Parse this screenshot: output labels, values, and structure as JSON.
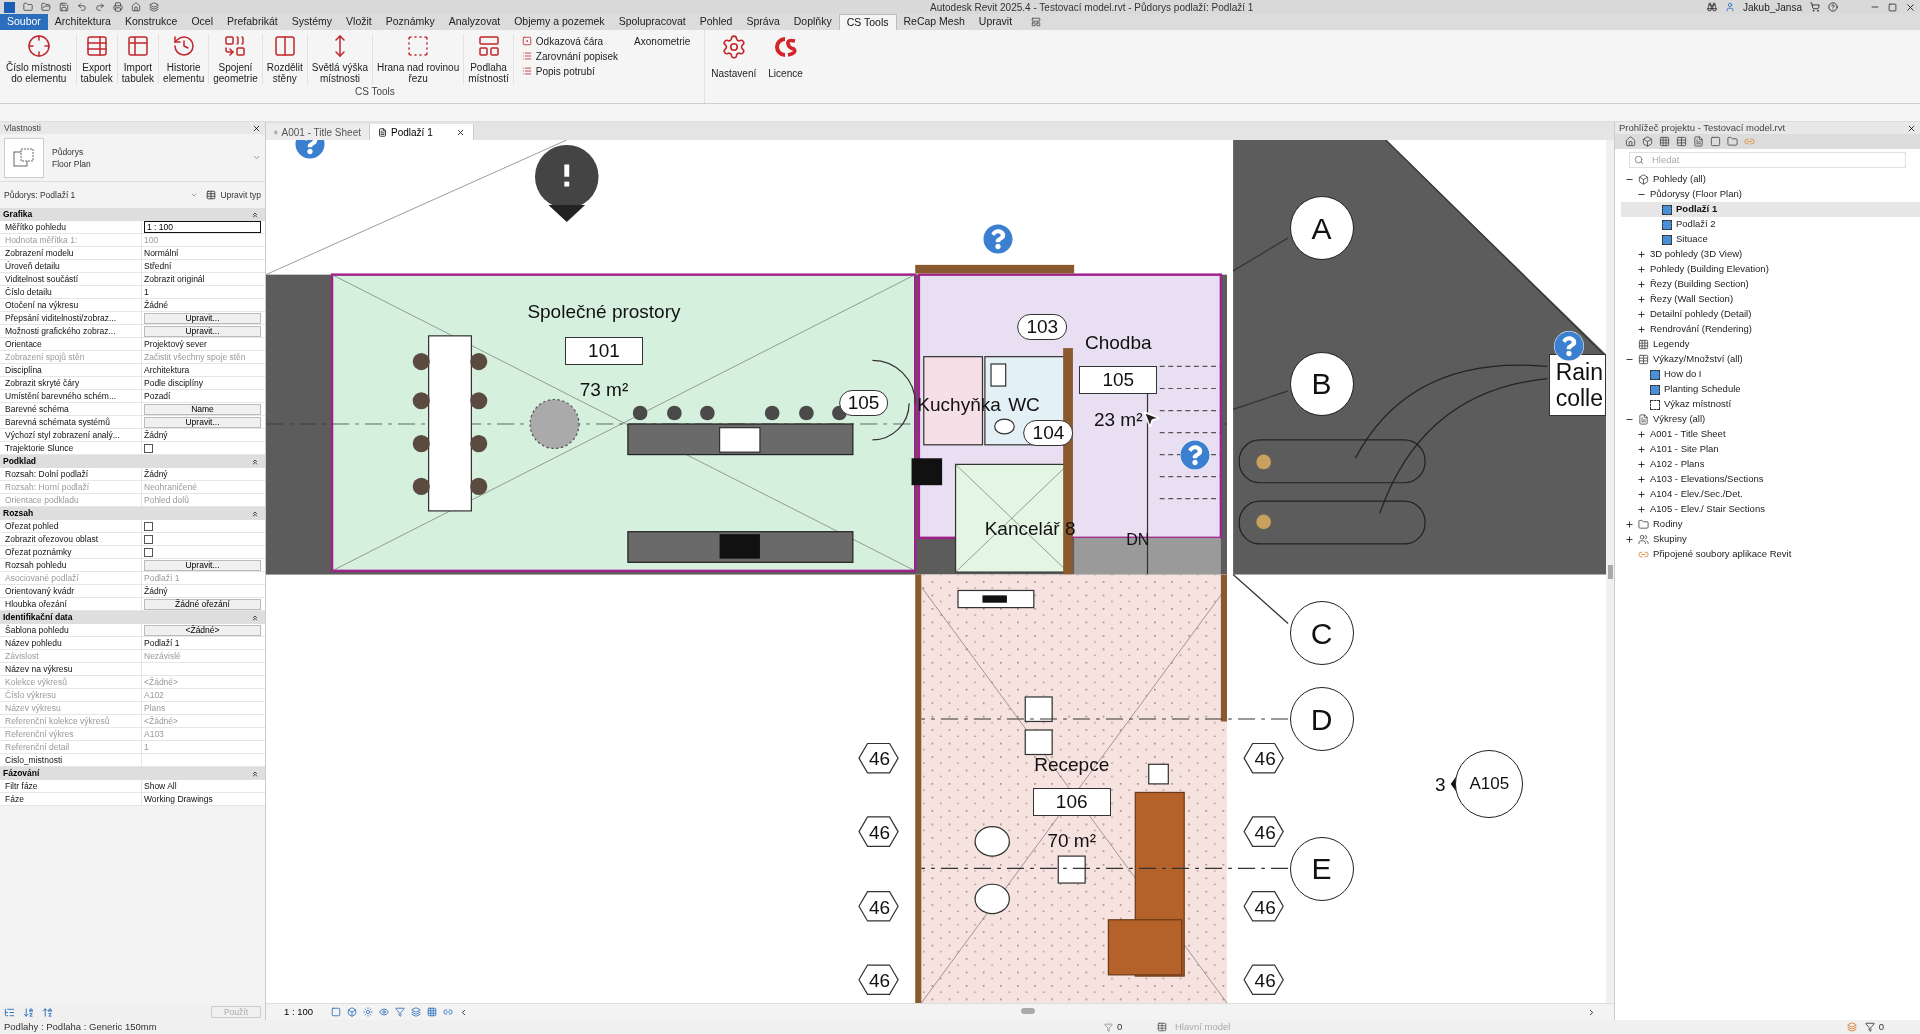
{
  "title_bar": {
    "title": "Autodesk Revit 2025.4 - Testovací model.rvt - Půdorys podlaží: Podlaží 1",
    "user": "Jakub_Jansa"
  },
  "menu_tabs": [
    {
      "label": "Soubor",
      "kind": "file",
      "selected": false
    },
    {
      "label": "Architektura",
      "kind": "tab",
      "selected": false
    },
    {
      "label": "Konstrukce",
      "kind": "tab",
      "selected": false
    },
    {
      "label": "Ocel",
      "kind": "tab",
      "selected": false
    },
    {
      "label": "Prefabrikát",
      "kind": "tab",
      "selected": false
    },
    {
      "label": "Systémy",
      "kind": "tab",
      "selected": false
    },
    {
      "label": "Vložit",
      "kind": "tab",
      "selected": false
    },
    {
      "label": "Poznámky",
      "kind": "tab",
      "selected": false
    },
    {
      "label": "Analyzovat",
      "kind": "tab",
      "selected": false
    },
    {
      "label": "Objemy a pozemek",
      "kind": "tab",
      "selected": false
    },
    {
      "label": "Spolupracovat",
      "kind": "tab",
      "selected": false
    },
    {
      "label": "Pohled",
      "kind": "tab",
      "selected": false
    },
    {
      "label": "Správa",
      "kind": "tab",
      "selected": false
    },
    {
      "label": "Doplňky",
      "kind": "tab",
      "selected": false
    },
    {
      "label": "CS Tools",
      "kind": "tab",
      "selected": true
    },
    {
      "label": "ReCap Mesh",
      "kind": "tab",
      "selected": false
    },
    {
      "label": "Upravit",
      "kind": "tab",
      "selected": false
    }
  ],
  "ribbon": {
    "large_buttons": [
      "Číslo místnosti\ndo elementu",
      "Export\ntabulek",
      "Import\ntabulek",
      "Historie\nelementu",
      "Spojení\ngeometrie",
      "Rozdělit\nstěny",
      "Světlá výška\nmístnosti",
      "Hrana nad rovinou\nřezu",
      "Podlaha\nmístností"
    ],
    "small_buttons": [
      "Odkazová čára",
      "Zarovnání popisek",
      "Popis potrubí"
    ],
    "axonometry": "Axonometrie",
    "extra_buttons": [
      "Nastavení",
      "Licence"
    ],
    "panel_label": "CS Tools"
  },
  "properties": {
    "title": "Vlastnosti",
    "type_name": "Půdorys",
    "type_sub": "Floor Plan",
    "selector": "Půdorys: Podlaží 1",
    "edit_type": "Upravit typ",
    "groups": [
      {
        "name": "Grafika",
        "rows": [
          {
            "label": "Měřítko pohledu",
            "value": "1 : 100",
            "kind": "field",
            "disabled": false
          },
          {
            "label": "Hodnota měřítka   1:",
            "value": "100",
            "kind": "text",
            "disabled": true
          },
          {
            "label": "Zobrazení modelu",
            "value": "Normální",
            "kind": "text",
            "disabled": false
          },
          {
            "label": "Úroveň detailu",
            "value": "Střední",
            "kind": "text",
            "disabled": false
          },
          {
            "label": "Viditelnost součástí",
            "value": "Zobrazit originál",
            "kind": "text",
            "disabled": false
          },
          {
            "label": "Číslo detailu",
            "value": "1",
            "kind": "text",
            "disabled": false
          },
          {
            "label": "Otočení na výkresu",
            "value": "Žádné",
            "kind": "text",
            "disabled": false
          },
          {
            "label": "Přepsání viditelnosti/zobraz...",
            "value": "Upravit...",
            "kind": "button",
            "disabled": false
          },
          {
            "label": "Možnosti grafického zobraz...",
            "value": "Upravit...",
            "kind": "button",
            "disabled": false
          },
          {
            "label": "Orientace",
            "value": "Projektový sever",
            "kind": "text",
            "disabled": false
          },
          {
            "label": "Zobrazení spojů stěn",
            "value": "Začistit všechny spoje stěn",
            "kind": "text",
            "disabled": true
          },
          {
            "label": "Disciplína",
            "value": "Architektura",
            "kind": "text",
            "disabled": false
          },
          {
            "label": "Zobrazit skryté čáry",
            "value": "Podle disciplíny",
            "kind": "text",
            "disabled": false
          },
          {
            "label": "Umístění barevného schém...",
            "value": "Pozadí",
            "kind": "text",
            "disabled": false
          },
          {
            "label": "Barevné schéma",
            "value": "Name",
            "kind": "button",
            "disabled": false
          },
          {
            "label": "Barevná schémata systémů",
            "value": "Upravit...",
            "kind": "button",
            "disabled": false
          },
          {
            "label": "Výchozí styl zobrazení analý...",
            "value": "Žádný",
            "kind": "text",
            "disabled": false
          },
          {
            "label": "Trajektorie Slunce",
            "kind": "checkbox",
            "checked": false,
            "disabled": false
          }
        ]
      },
      {
        "name": "Podklad",
        "rows": [
          {
            "label": "Rozsah: Dolní podlaží",
            "value": "Žádný",
            "kind": "text",
            "disabled": false
          },
          {
            "label": "Rozsah: Horní podlaží",
            "value": "Neohraničené",
            "kind": "text",
            "disabled": true
          },
          {
            "label": "Orientace podkladu",
            "value": "Pohled dolů",
            "kind": "text",
            "disabled": true
          }
        ]
      },
      {
        "name": "Rozsah",
        "rows": [
          {
            "label": "Ořezat pohled",
            "kind": "checkbox",
            "checked": false,
            "disabled": false
          },
          {
            "label": "Zobrazit ořezovou oblast",
            "kind": "checkbox",
            "checked": false,
            "disabled": false
          },
          {
            "label": "Ořezat poznámky",
            "kind": "checkbox",
            "checked": false,
            "disabled": false
          },
          {
            "label": "Rozsah pohledu",
            "value": "Upravit...",
            "kind": "button",
            "disabled": false
          },
          {
            "label": "Asociované podlaží",
            "value": "Podlaží 1",
            "kind": "text",
            "disabled": true
          },
          {
            "label": "Orientovaný kvádr",
            "value": "Žádný",
            "kind": "text",
            "disabled": false
          },
          {
            "label": "Hloubka ořezání",
            "value": "Žádné ořezání",
            "kind": "button",
            "disabled": false
          }
        ]
      },
      {
        "name": "Identifikační data",
        "rows": [
          {
            "label": "Šablona pohledu",
            "value": "<Žádné>",
            "kind": "button",
            "disabled": false
          },
          {
            "label": "Název pohledu",
            "value": "Podlaží 1",
            "kind": "text",
            "disabled": false
          },
          {
            "label": "Závislost",
            "value": "Nezávislé",
            "kind": "text",
            "disabled": true
          },
          {
            "label": "Název na výkresu",
            "kind": "text",
            "disabled": false
          },
          {
            "label": "Kolekce výkresů",
            "value": "<Žádné>",
            "kind": "text",
            "disabled": true
          },
          {
            "label": "Číslo výkresu",
            "value": "A102",
            "kind": "text",
            "disabled": true
          },
          {
            "label": "Název výkresu",
            "value": "Plans",
            "kind": "text",
            "disabled": true
          },
          {
            "label": "Referenční kolekce výkresů",
            "value": "<Žádné>",
            "kind": "text",
            "disabled": true
          },
          {
            "label": "Referenční výkres",
            "value": "A103",
            "kind": "text",
            "disabled": true
          },
          {
            "label": "Referenční detail",
            "value": "1",
            "kind": "text",
            "disabled": true
          },
          {
            "label": "Cislo_mistnosti",
            "kind": "text",
            "disabled": false
          }
        ]
      },
      {
        "name": "Fázování",
        "rows": [
          {
            "label": "Filtr fáze",
            "value": "Show All",
            "kind": "text",
            "disabled": false
          },
          {
            "label": "Fáze",
            "value": "Working Drawings",
            "kind": "text",
            "disabled": false
          }
        ]
      }
    ],
    "apply": "Použít"
  },
  "view_tabs": [
    {
      "label": "A001 - Title Sheet",
      "selected": false
    },
    {
      "label": "Podlaží 1",
      "selected": true
    }
  ],
  "plan": {
    "rooms": [
      {
        "name": "Společné prostory",
        "number": "101",
        "area": "73 m²"
      },
      {
        "name": "Chodba",
        "number": "105",
        "area": "23 m²"
      },
      {
        "name": "Recepce",
        "number": "106",
        "area": "70 m²"
      },
      {
        "name": "Kuchyňka"
      },
      {
        "name": "WC"
      },
      {
        "name": "Kancelář 8"
      }
    ],
    "tags": [
      "103",
      "105",
      "104"
    ],
    "stair_label": "DN",
    "grid_heads": [
      "A",
      "B",
      "C",
      "D",
      "E"
    ],
    "level_marks": [
      "46",
      "46",
      "46",
      "46",
      "46",
      "46",
      "46",
      "46"
    ],
    "section": {
      "number": "3",
      "sheet": "A105"
    },
    "note": [
      "Rain",
      "colle"
    ]
  },
  "view_bar": {
    "scale": "1 : 100"
  },
  "browser": {
    "title": "Prohlížeč projektu - Testovací model.rvt",
    "search_placeholder": "Hledat",
    "tree": [
      {
        "label": "Pohledy (all)",
        "kind": "views",
        "expanded": true,
        "selected": false,
        "children": [
          {
            "label": "Půdorysy (Floor Plan)",
            "kind": "group",
            "expanded": true,
            "selected": false,
            "children": [
              {
                "label": "Podlaží 1",
                "kind": "view",
                "selected": true
              },
              {
                "label": "Podlaží 2",
                "kind": "view",
                "selected": false
              },
              {
                "label": "Situace",
                "kind": "view",
                "selected": false
              }
            ]
          },
          {
            "label": "3D pohledy (3D View)",
            "kind": "group",
            "expanded": false,
            "selected": false
          },
          {
            "label": "Pohledy (Building Elevation)",
            "kind": "group",
            "expanded": false,
            "selected": false
          },
          {
            "label": "Řezy (Building Section)",
            "kind": "group",
            "expanded": false,
            "selected": false
          },
          {
            "label": "Řezy (Wall Section)",
            "kind": "group",
            "expanded": false,
            "selected": false
          },
          {
            "label": "Detailní pohledy (Detail)",
            "kind": "group",
            "expanded": false,
            "selected": false
          },
          {
            "label": "Rendrování (Rendering)",
            "kind": "group",
            "expanded": false,
            "selected": false
          }
        ]
      },
      {
        "label": "Legendy",
        "kind": "legend",
        "selected": false
      },
      {
        "label": "Výkazy/Množství (all)",
        "kind": "schedule",
        "expanded": true,
        "selected": false,
        "children": [
          {
            "label": "How do I",
            "kind": "view",
            "selected": false
          },
          {
            "label": "Planting Schedule",
            "kind": "view",
            "selected": false
          },
          {
            "label": "Výkaz místností",
            "kind": "blank",
            "selected": false
          }
        ]
      },
      {
        "label": "Výkresy (all)",
        "kind": "sheets",
        "expanded": true,
        "selected": false,
        "children": [
          {
            "label": "A001 - Title Sheet",
            "kind": "group",
            "expanded": false,
            "selected": false
          },
          {
            "label": "A101 - Site Plan",
            "kind": "group",
            "expanded": false,
            "selected": false
          },
          {
            "label": "A102 - Plans",
            "kind": "group",
            "expanded": false,
            "selected": false
          },
          {
            "label": "A103 - Elevations/Sections",
            "kind": "group",
            "expanded": false,
            "selected": false
          },
          {
            "label": "A104 - Elev./Sec./Det.",
            "kind": "group",
            "expanded": false,
            "selected": false
          },
          {
            "label": "A105 - Elev./ Stair Sections",
            "kind": "group",
            "expanded": false,
            "selected": false
          }
        ]
      },
      {
        "label": "Rodiny",
        "kind": "families",
        "expanded": false,
        "selected": false
      },
      {
        "label": "Skupiny",
        "kind": "groups",
        "expanded": false,
        "selected": false
      },
      {
        "label": "Připojené soubory aplikace Revit",
        "kind": "links",
        "selected": false
      }
    ]
  },
  "status_bar": {
    "left": "Podlahy : Podlaha : Generic 150mm",
    "count_a": "0",
    "workset": "Hlavní model",
    "count_b": "0"
  }
}
